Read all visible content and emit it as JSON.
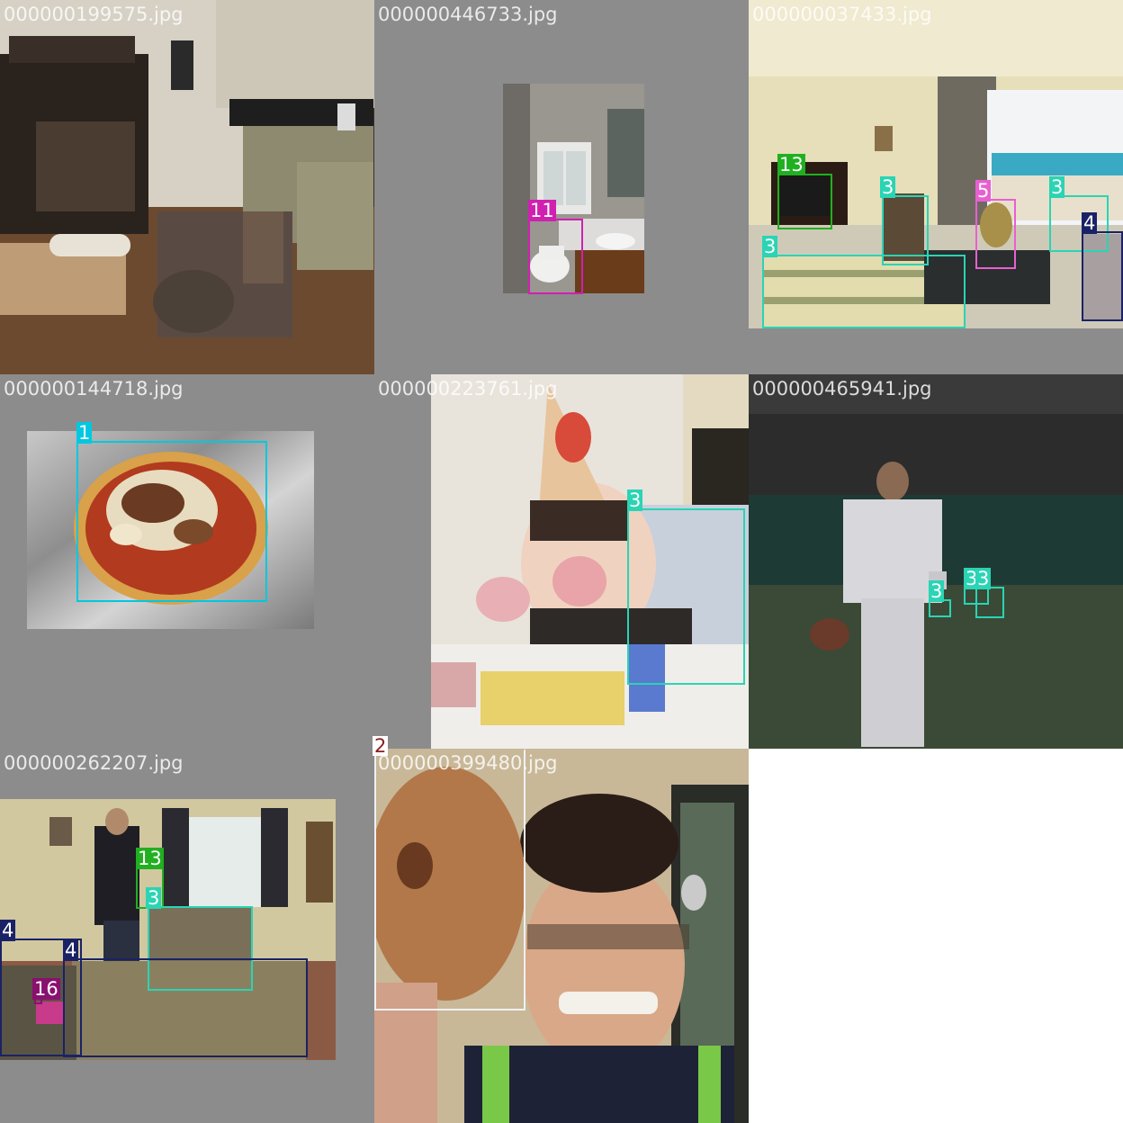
{
  "class_colors": {
    "1": "#00c8e0",
    "2": "#8a1e1e",
    "3": "#2ad4b4",
    "4": "#1a2266",
    "5": "#e860d0",
    "11": "#d020b0",
    "13": "#20b020",
    "16": "#8a1070"
  },
  "tiles": [
    {
      "filename": "000000199575.jpg",
      "scene": "kitchen with black wood stove and a cat on a rug",
      "boxes": []
    },
    {
      "filename": "000000446733.jpg",
      "scene": "small bathroom with toilet and sink",
      "boxes": [
        {
          "label": "11"
        }
      ]
    },
    {
      "filename": "000000037433.jpg",
      "scene": "hotel living room with sea-view balcony",
      "boxes": [
        {
          "label": "13"
        },
        {
          "label": "3"
        },
        {
          "label": "5"
        },
        {
          "label": "3"
        },
        {
          "label": "4"
        },
        {
          "label": "3"
        }
      ]
    },
    {
      "filename": "000000144718.jpg",
      "scene": "pizza on aluminum foil",
      "boxes": [
        {
          "label": "1"
        }
      ]
    },
    {
      "filename": "000000223761.jpg",
      "scene": "toddler in party hat eating cake in high chair",
      "boxes": [
        {
          "label": "3"
        }
      ]
    },
    {
      "filename": "000000465941.jpg",
      "scene": "baseball player walking on field with glove",
      "boxes": [
        {
          "label": "3"
        },
        {
          "label": "3"
        },
        {
          "label": "3"
        }
      ]
    },
    {
      "filename": "000000262207.jpg",
      "scene": "living room with man at tv, armchairs and sofa",
      "boxes": [
        {
          "label": "13"
        },
        {
          "label": "3"
        },
        {
          "label": "4"
        },
        {
          "label": "4"
        },
        {
          "label": "16"
        }
      ]
    },
    {
      "filename": "000000399480.jpg",
      "scene": "smiling man holding a glazed donut",
      "boxes": [
        {
          "label": "2"
        }
      ]
    }
  ]
}
